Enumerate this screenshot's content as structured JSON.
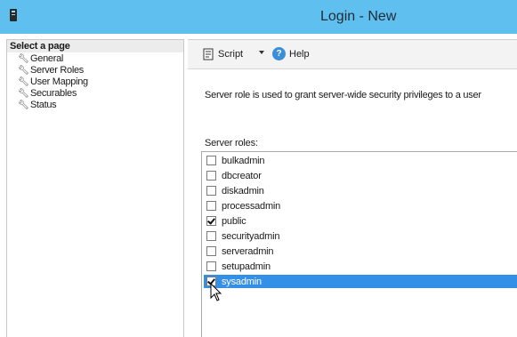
{
  "window": {
    "title": "Login - New"
  },
  "sidebar": {
    "header": "Select a page",
    "items": [
      {
        "label": "General",
        "icon": "wrench-icon"
      },
      {
        "label": "Server Roles",
        "icon": "wrench-icon"
      },
      {
        "label": "User Mapping",
        "icon": "wrench-icon"
      },
      {
        "label": "Securables",
        "icon": "wrench-icon"
      },
      {
        "label": "Status",
        "icon": "wrench-icon"
      }
    ]
  },
  "toolbar": {
    "script_label": "Script",
    "help_label": "Help"
  },
  "main": {
    "description": "Server role is used to grant server-wide security privileges to a user",
    "roles_label": "Server roles:",
    "roles": [
      {
        "name": "bulkadmin",
        "checked": false,
        "selected": false
      },
      {
        "name": "dbcreator",
        "checked": false,
        "selected": false
      },
      {
        "name": "diskadmin",
        "checked": false,
        "selected": false
      },
      {
        "name": "processadmin",
        "checked": false,
        "selected": false
      },
      {
        "name": "public",
        "checked": true,
        "selected": false
      },
      {
        "name": "securityadmin",
        "checked": false,
        "selected": false
      },
      {
        "name": "serveradmin",
        "checked": false,
        "selected": false
      },
      {
        "name": "setupadmin",
        "checked": false,
        "selected": false
      },
      {
        "name": "sysadmin",
        "checked": true,
        "selected": true
      }
    ]
  },
  "colors": {
    "titlebar": "#5fc0f0",
    "selection": "#3390e6"
  }
}
